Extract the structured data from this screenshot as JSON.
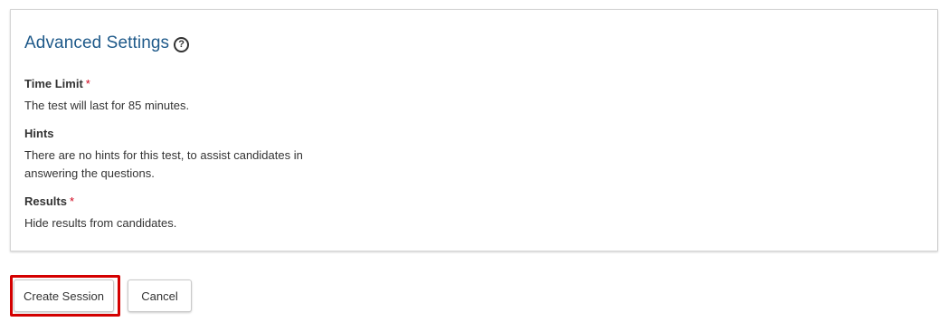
{
  "advanced_settings": {
    "title": "Advanced Settings",
    "help_glyph": "?",
    "required_marker": "*",
    "time_limit": {
      "label": "Time Limit",
      "text": "The test will last for 85 minutes."
    },
    "hints": {
      "label": "Hints",
      "text": "There are no hints for this test, to assist candidates in answering the questions."
    },
    "results": {
      "label": "Results",
      "text": "Hide results from candidates."
    }
  },
  "actions": {
    "create_session_label": "Create Session",
    "cancel_label": "Cancel"
  },
  "colors": {
    "title": "#1f5a8a",
    "required": "#d0021b",
    "highlight": "#d40000"
  },
  "icons": {
    "help": "help-circle-icon"
  }
}
